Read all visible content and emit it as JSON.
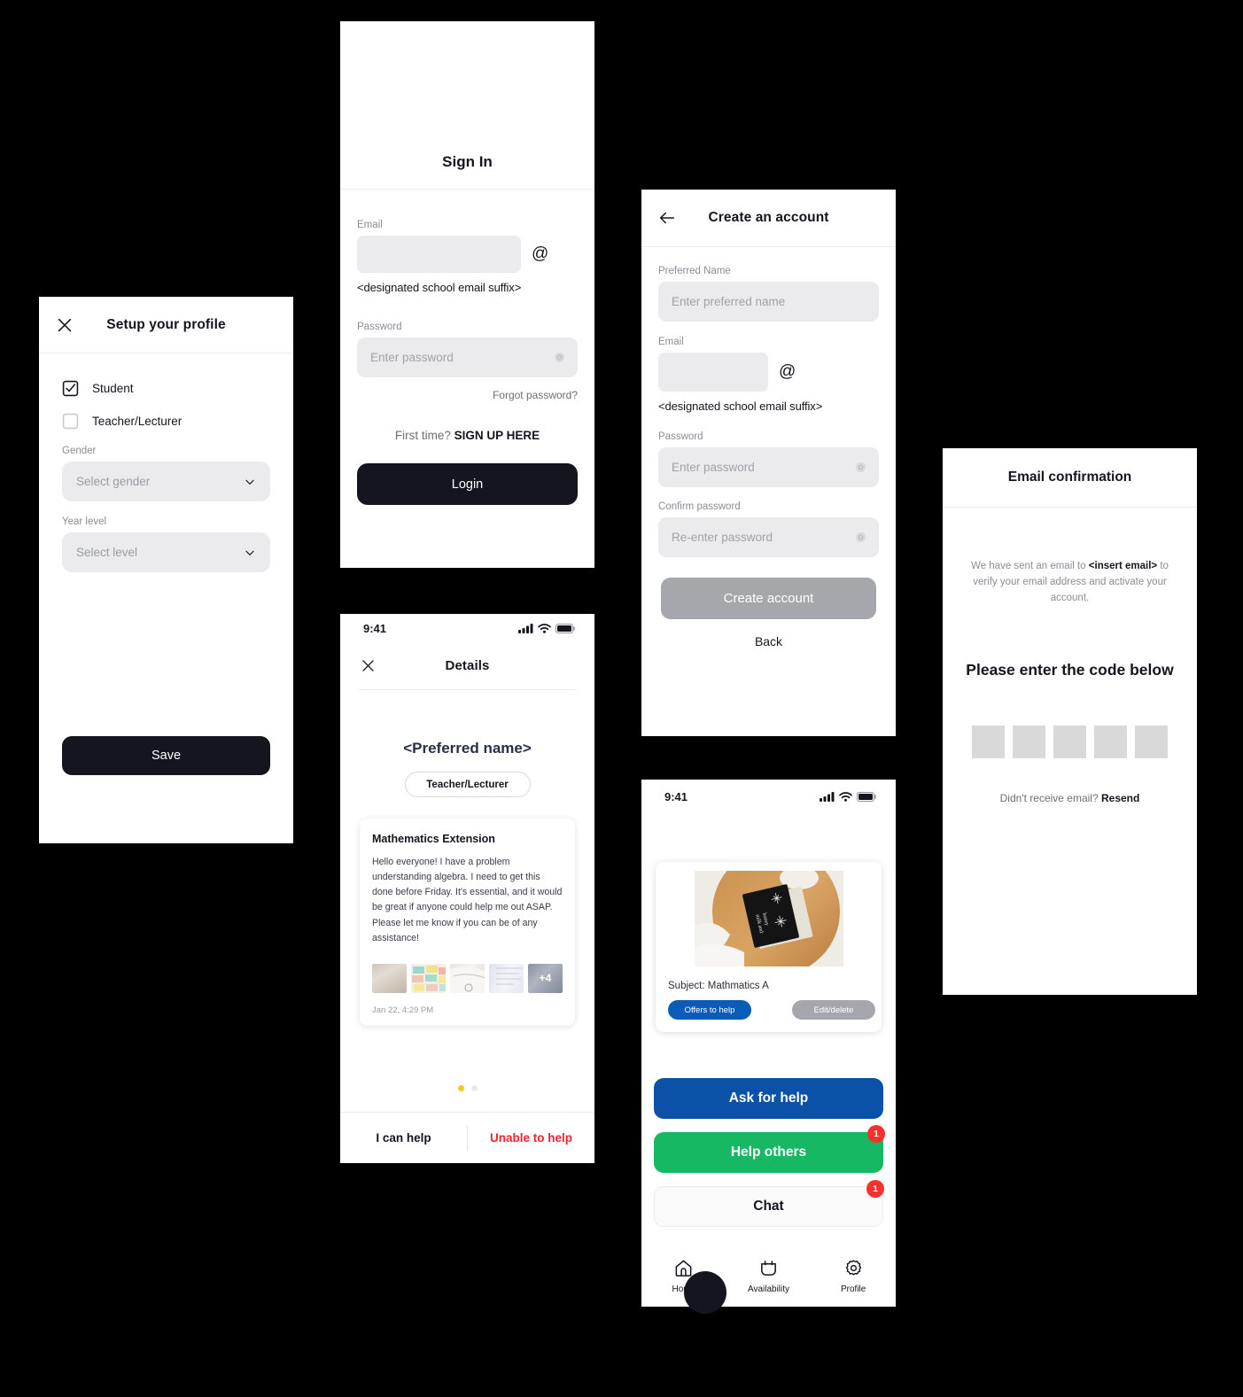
{
  "profile_screen": {
    "close_icon": "close-icon",
    "title": "Setup your profile",
    "roles": [
      {
        "label": "Student",
        "checked": true
      },
      {
        "label": "Teacher/Lecturer",
        "checked": false
      }
    ],
    "gender": {
      "label": "Gender",
      "placeholder": "Select gender"
    },
    "year_level": {
      "label": "Year level",
      "placeholder": "Select level"
    },
    "save_label": "Save"
  },
  "signin_screen": {
    "title": "Sign In",
    "email": {
      "label": "Email",
      "value": "",
      "at_symbol": "@",
      "suffix": "<designated school email suffix>"
    },
    "password": {
      "label": "Password",
      "placeholder": "Enter password"
    },
    "forgot_label": "Forgot password?",
    "signup_prefix": "First time?",
    "signup_link": "SIGN UP HERE",
    "login_label": "Login"
  },
  "create_account_screen": {
    "back_icon": "arrow-left-icon",
    "title": "Create an account",
    "preferred_name": {
      "label": "Preferred Name",
      "placeholder": "Enter preferred name"
    },
    "email": {
      "label": "Email",
      "value": "",
      "at_symbol": "@",
      "suffix": "<designated school email suffix>"
    },
    "password": {
      "label": "Password",
      "placeholder": "Enter password"
    },
    "confirm_password": {
      "label": "Confirm password",
      "placeholder": "Re-enter password"
    },
    "create_label": "Create account",
    "back_label": "Back"
  },
  "email_confirmation_screen": {
    "title": "Email confirmation",
    "body_prefix": "We have sent an email to ",
    "body_email": "<insert email>",
    "body_suffix": " to verify your email address and activate your account.",
    "heading": "Please enter the code below",
    "code_boxes": [
      "",
      "",
      "",
      "",
      ""
    ],
    "resend_prefix": "Didn't receive email? ",
    "resend_link": "Resend"
  },
  "details_screen": {
    "status_bar": {
      "time": "9:41",
      "signal": "signal-icon",
      "wifi": "wifi-icon",
      "battery": "battery-icon"
    },
    "close_icon": "close-icon",
    "title": "Details",
    "preferred_name": "<Preferred name>",
    "role_pill": "Teacher/Lecturer",
    "post": {
      "title": "Mathematics Extension",
      "body": "Hello everyone! I have a problem understanding algebra. I need to get this done before Friday. It's essential, and it would be great if anyone could help me out ASAP. Please let me know if you can be of any assistance!",
      "attachment_count": 5,
      "more_badge": "+4",
      "timestamp": "Jan 22, 4:29 PM"
    },
    "pagination": {
      "count": 2,
      "active_index": 0,
      "active_color": "#FFC61A",
      "inactive_color": "#E6E9ED"
    },
    "actions": [
      {
        "label": "I can help",
        "color": "#15151f"
      },
      {
        "label": "Unable to help",
        "color": "#F5222D"
      }
    ]
  },
  "home_screen": {
    "status_bar": {
      "time": "9:41",
      "signal": "signal-icon",
      "wifi": "wifi-icon",
      "battery": "battery-icon"
    },
    "card": {
      "image": "book-on-table-photo",
      "subject": "Subject: Mathmatics A",
      "offers_label": "Offers to help",
      "offers_color": "#0B5CB8",
      "edit_label": "Edit/delete",
      "edit_color": "#A6A7AD"
    },
    "buttons": [
      {
        "label": "Ask for help",
        "bg": "#0B51A8",
        "text_color": "#ffffff",
        "badge": ""
      },
      {
        "label": "Help others",
        "bg": "#16B864",
        "text_color": "#ffffff",
        "badge": "1"
      },
      {
        "label": "Chat",
        "bg": "#FAFAFA",
        "text_color": "#15151f",
        "badge": "1"
      }
    ],
    "tabs": [
      {
        "label": "Home",
        "icon": "home-icon"
      },
      {
        "label": "Availability",
        "icon": "calendar-icon"
      },
      {
        "label": "Profile",
        "icon": "gear-icon"
      }
    ]
  }
}
